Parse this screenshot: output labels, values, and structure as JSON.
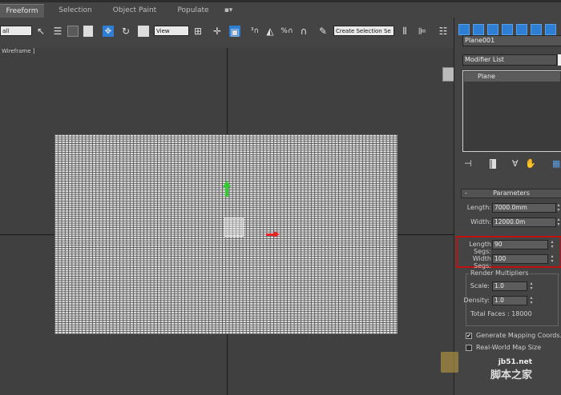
{
  "ribbon": {
    "tabs": [
      "Freeform",
      "Selection",
      "Object Paint",
      "Populate"
    ],
    "extra_icon": "dot-dropdown-icon"
  },
  "toolbar": {
    "filter_value": "all",
    "reference_coord": "View",
    "named_selection": "Create Selection Se"
  },
  "viewport": {
    "label": "Wireframe ]"
  },
  "command_panel": {
    "object_name": "Plane001",
    "modifier_list": "Modifier List",
    "stack_item": "Plane"
  },
  "parameters": {
    "rollout_title": "Parameters",
    "rollout_sign": "-",
    "length_label": "Length:",
    "length_value": "7000.0mm",
    "width_label": "Width:",
    "width_value": "12000.0m",
    "length_segs_label": "Length Segs:",
    "length_segs_value": "90",
    "width_segs_label": "Width Segs:",
    "width_segs_value": "100",
    "render_multipliers_label": "Render Multipliers",
    "scale_label": "Scale:",
    "scale_value": "1.0",
    "density_label": "Density:",
    "density_value": "1.0",
    "total_faces": "Total Faces : 18000",
    "gen_mapping_label": "Generate Mapping Coords.",
    "gen_mapping_checked": "✔",
    "real_world_label": "Real-World Map Size"
  },
  "watermark": {
    "line1": "jb51.net",
    "line2": "脚本之家"
  },
  "colors": {
    "accent_blue": "#2e7fd3",
    "highlight_red": "#c01010",
    "gizmo_green": "#2ccf2c",
    "gizmo_red": "#e22222"
  }
}
